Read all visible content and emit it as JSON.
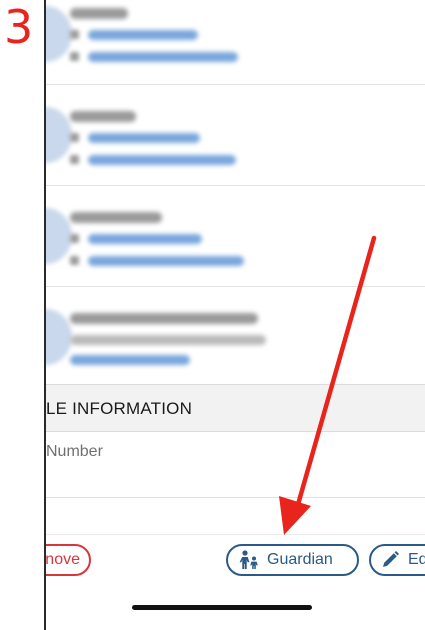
{
  "step": {
    "number": "3"
  },
  "section": {
    "header": "LE INFORMATION"
  },
  "field": {
    "label": "Number"
  },
  "actions": {
    "remove_label": "nove",
    "guardian_label": "Guardian",
    "edit_label": "Ed"
  },
  "icons": {
    "guardian": "family-icon",
    "edit": "pencil-icon"
  },
  "colors": {
    "step_number": "#e8241c",
    "remove": "#d8363a",
    "action_blue": "#2a5a87",
    "arrow": "#e8241c"
  }
}
